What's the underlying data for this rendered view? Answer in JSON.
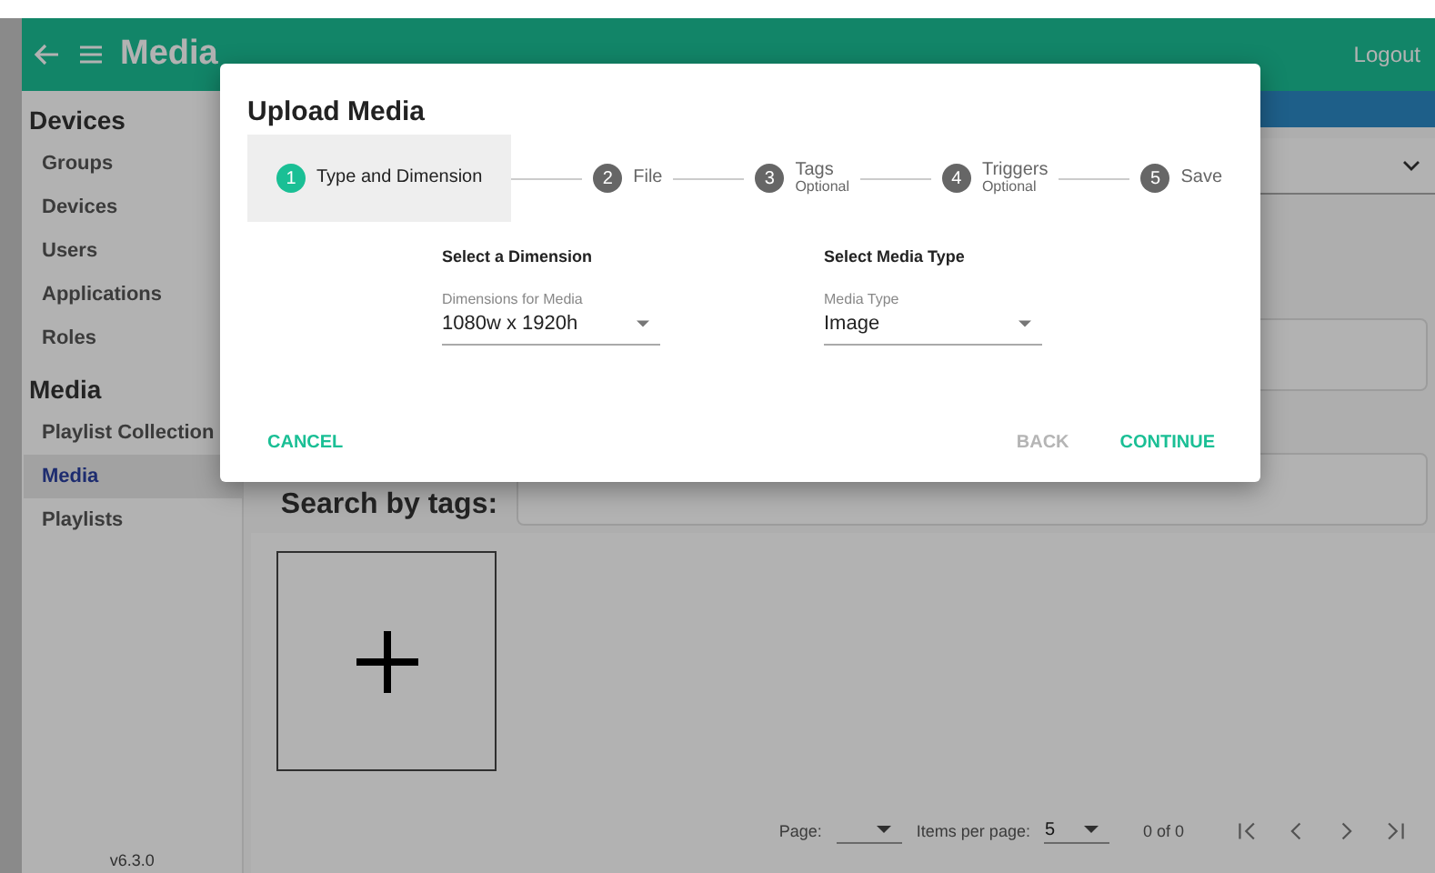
{
  "header": {
    "title": "Media",
    "logout": "Logout"
  },
  "sidebar": {
    "sections": [
      {
        "title": "Devices",
        "items": [
          {
            "label": "Groups",
            "selected": false
          },
          {
            "label": "Devices",
            "selected": false
          },
          {
            "label": "Users",
            "selected": false
          },
          {
            "label": "Applications",
            "selected": false
          },
          {
            "label": "Roles",
            "selected": false
          }
        ]
      },
      {
        "title": "Media",
        "items": [
          {
            "label": "Playlist Collection",
            "selected": false
          },
          {
            "label": "Media",
            "selected": true
          },
          {
            "label": "Playlists",
            "selected": false
          }
        ]
      }
    ],
    "version": "v6.3.0"
  },
  "content": {
    "search_label": "Search by tags:"
  },
  "pagination": {
    "page_label": "Page:",
    "items_label": "Items per page:",
    "items_value": "5",
    "range": "0 of 0"
  },
  "dialog": {
    "title": "Upload Media",
    "steps": [
      {
        "number": "1",
        "label": "Type and Dimension",
        "selected": true
      },
      {
        "number": "2",
        "label": "File",
        "selected": false
      },
      {
        "number": "3",
        "label": "Tags",
        "optional": "Optional",
        "selected": false
      },
      {
        "number": "4",
        "label": "Triggers",
        "optional": "Optional",
        "selected": false
      },
      {
        "number": "5",
        "label": "Save",
        "selected": false
      }
    ],
    "fields": [
      {
        "heading": "Select a Dimension",
        "label": "Dimensions for Media",
        "value": "1080w x 1920h"
      },
      {
        "heading": "Select Media Type",
        "label": "Media Type",
        "value": "Image"
      }
    ],
    "cancel": "CANCEL",
    "back": {
      "label": "BACK",
      "disabled": true
    },
    "continue": "CONTINUE"
  }
}
